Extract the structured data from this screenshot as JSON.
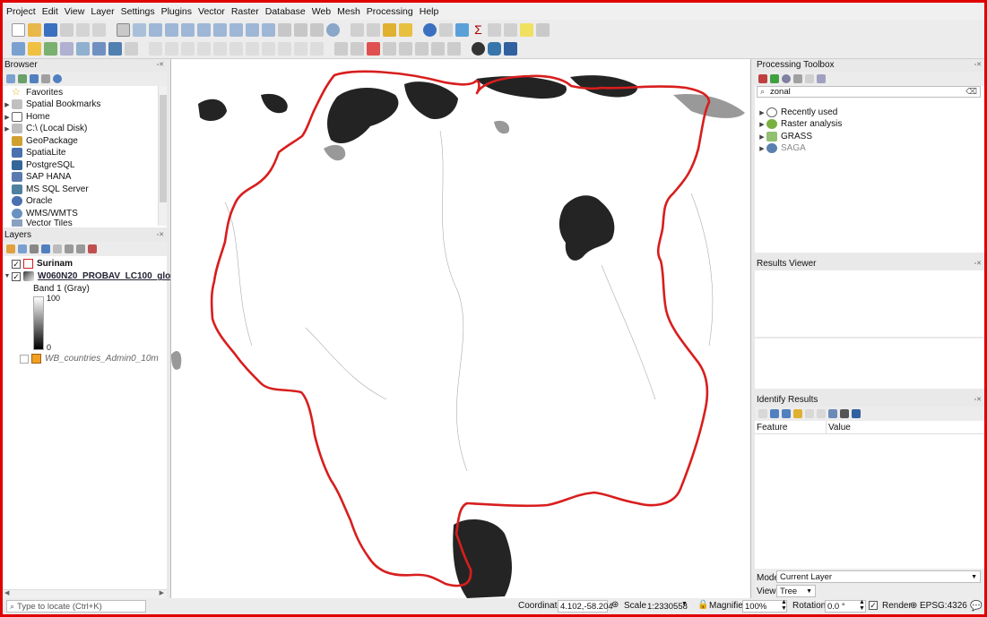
{
  "menu": [
    "Project",
    "Edit",
    "View",
    "Layer",
    "Settings",
    "Plugins",
    "Vector",
    "Raster",
    "Database",
    "Web",
    "Mesh",
    "Processing",
    "Help"
  ],
  "browser": {
    "title": "Browser",
    "items": [
      {
        "label": "Favorites",
        "icon": "star-icon",
        "expand": false
      },
      {
        "label": "Spatial Bookmarks",
        "icon": "bookmark-icon",
        "expand": true
      },
      {
        "label": "Home",
        "icon": "home-icon",
        "expand": true
      },
      {
        "label": "C:\\ (Local Disk)",
        "icon": "disk-icon",
        "expand": true
      },
      {
        "label": "GeoPackage",
        "icon": "geopackage-icon",
        "expand": false
      },
      {
        "label": "SpatiaLite",
        "icon": "spatialite-icon",
        "expand": false
      },
      {
        "label": "PostgreSQL",
        "icon": "postgresql-icon",
        "expand": false
      },
      {
        "label": "SAP HANA",
        "icon": "sap-hana-icon",
        "expand": false
      },
      {
        "label": "MS SQL Server",
        "icon": "mssql-icon",
        "expand": false
      },
      {
        "label": "Oracle",
        "icon": "oracle-icon",
        "expand": false
      },
      {
        "label": "WMS/WMTS",
        "icon": "wms-icon",
        "expand": false
      },
      {
        "label": "Vector Tiles",
        "icon": "vector-tiles-icon",
        "expand": false
      }
    ]
  },
  "layers": {
    "title": "Layers",
    "items": [
      {
        "label": "Surinam",
        "checked": true
      },
      {
        "label": "W060N20_PROBAV_LC100_glo",
        "checked": true
      },
      {
        "label": "WB_countries_Admin0_10m",
        "checked": false
      }
    ],
    "band_label": "Band 1 (Gray)",
    "legend_max": "100",
    "legend_min": "0"
  },
  "processing": {
    "title": "Processing Toolbox",
    "search_value": "zonal",
    "items": [
      {
        "label": "Recently used",
        "icon": "clock-icon"
      },
      {
        "label": "Raster analysis",
        "icon": "qgis-icon"
      },
      {
        "label": "GRASS",
        "icon": "grass-icon"
      },
      {
        "label": "SAGA",
        "icon": "saga-icon"
      }
    ]
  },
  "results_viewer": {
    "title": "Results Viewer"
  },
  "identify": {
    "title": "Identify Results",
    "col_feature": "Feature",
    "col_value": "Value",
    "mode_label": "Mode",
    "mode_value": "Current Layer",
    "view_label": "View",
    "view_value": "Tree"
  },
  "status": {
    "locate_placeholder": "Type to locate (Ctrl+K)",
    "coordinate_label": "Coordinate",
    "coordinate_value": "4.102,-58.204",
    "scale_label": "Scale",
    "scale_value": "1:2330558",
    "magnifier_label": "Magnifier",
    "magnifier_value": "100%",
    "rotation_label": "Rotation",
    "rotation_value": "0.0 °",
    "render_label": "Render",
    "crs": "EPSG:4326"
  },
  "colors": {
    "boundary": "#d81e1e",
    "frame": "#e00000",
    "legend_swatch_wb": "#f0a020"
  }
}
